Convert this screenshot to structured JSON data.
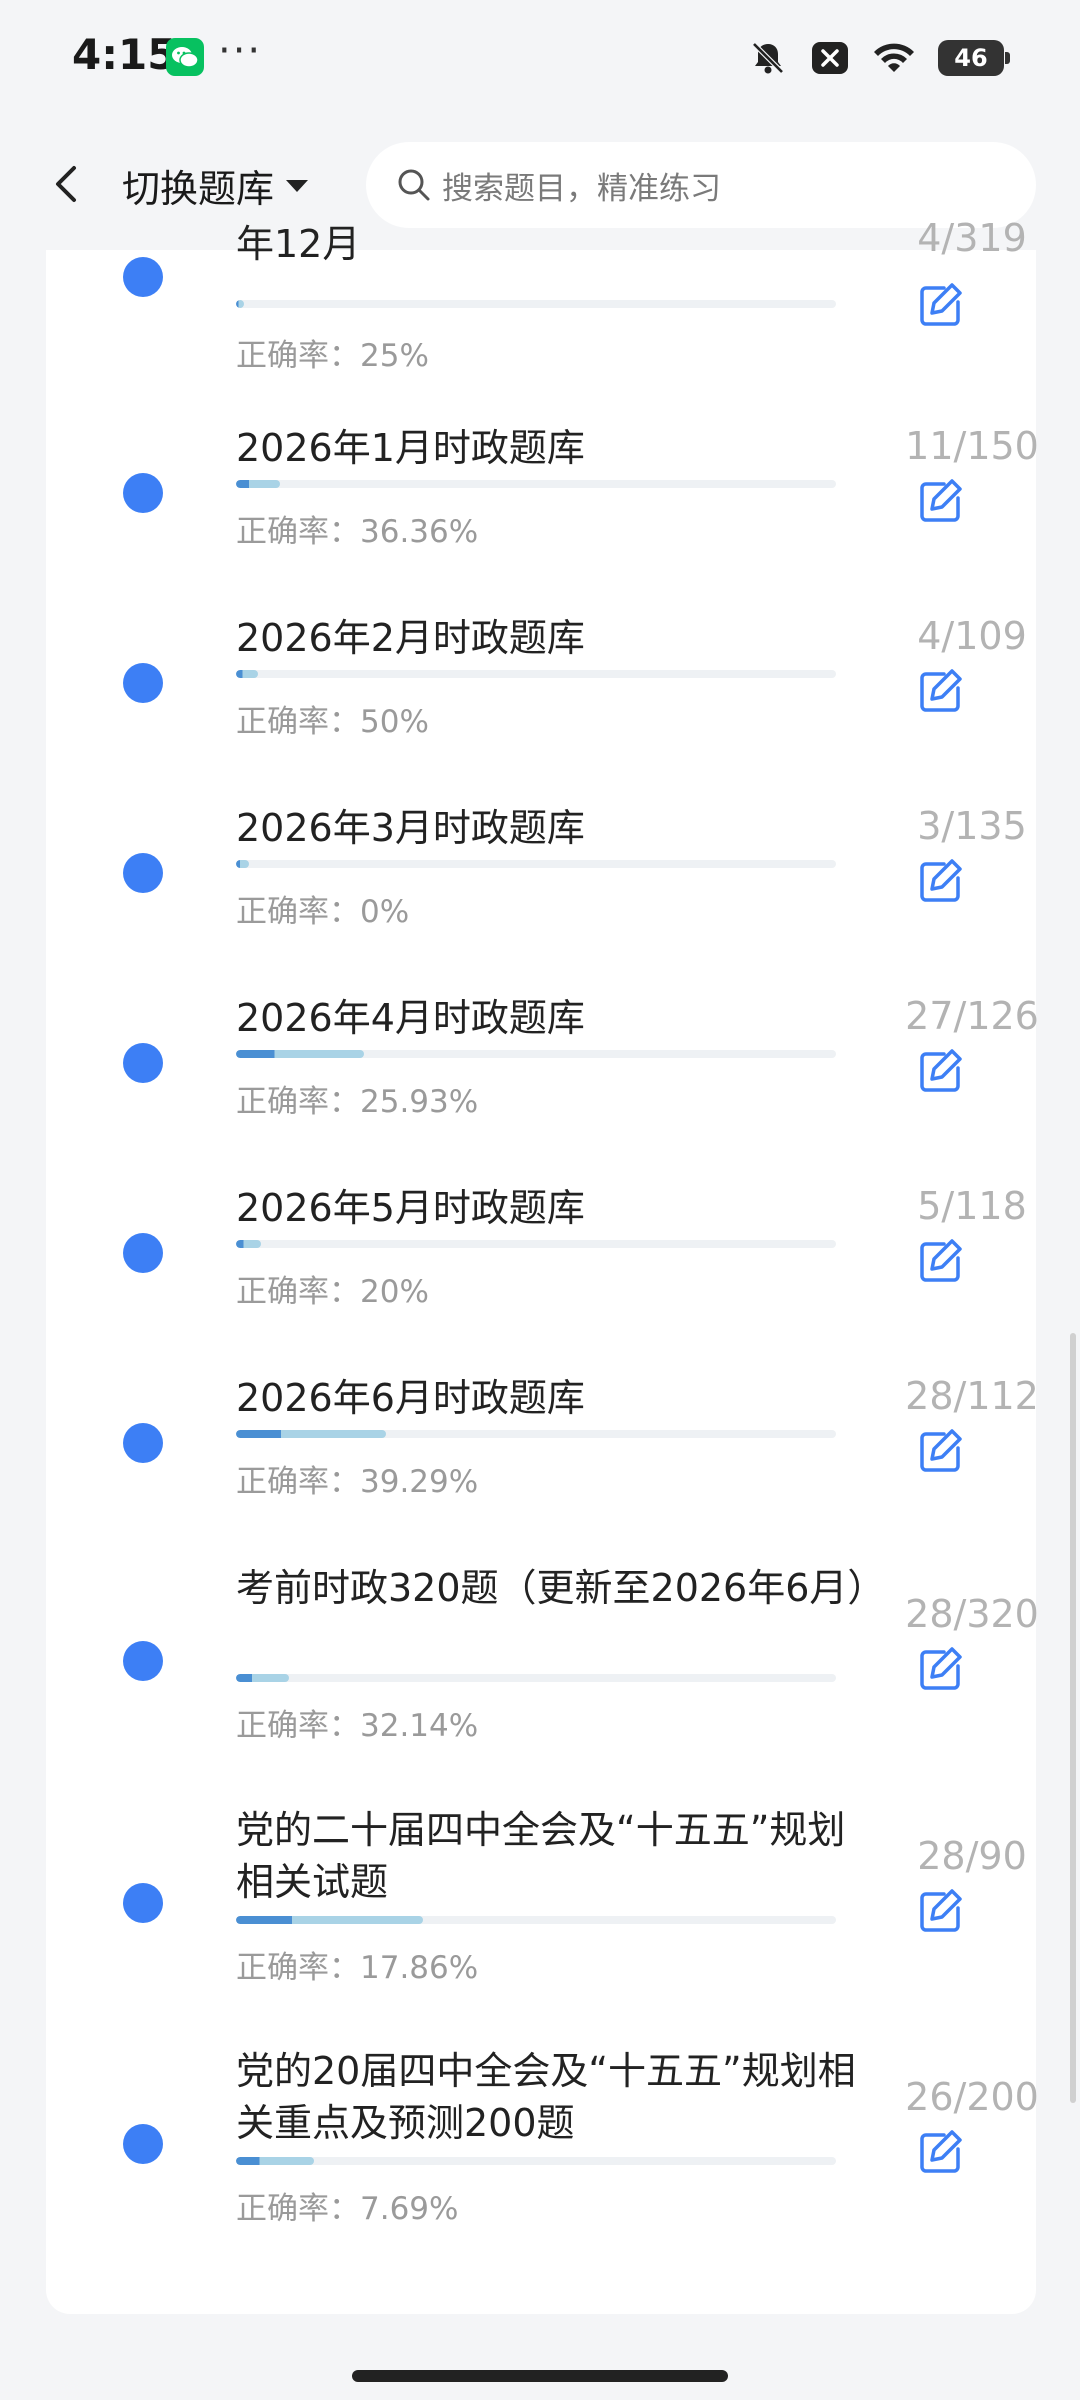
{
  "status_bar": {
    "time": "4:15",
    "dots": "···",
    "battery": "46",
    "icons": [
      "wechat-icon",
      "bell-off-icon",
      "close-box-icon",
      "wifi-icon",
      "battery-icon"
    ]
  },
  "header": {
    "switch_label": "切换题库",
    "search_placeholder": "搜索题目，精准练习"
  },
  "items": [
    {
      "title": "年12月",
      "count": "4/319",
      "accuracy": "正确率：25%",
      "progress": 0.013
    },
    {
      "title": "2026年1月时政题库",
      "count": "11/150",
      "accuracy": "正确率：36.36%",
      "progress": 0.073
    },
    {
      "title": "2026年2月时政题库",
      "count": "4/109",
      "accuracy": "正确率：50%",
      "progress": 0.037
    },
    {
      "title": "2026年3月时政题库",
      "count": "3/135",
      "accuracy": "正确率：0%",
      "progress": 0.022
    },
    {
      "title": "2026年4月时政题库",
      "count": "27/126",
      "accuracy": "正确率：25.93%",
      "progress": 0.214
    },
    {
      "title": "2026年5月时政题库",
      "count": "5/118",
      "accuracy": "正确率：20%",
      "progress": 0.042
    },
    {
      "title": "2026年6月时政题库",
      "count": "28/112",
      "accuracy": "正确率：39.29%",
      "progress": 0.25
    },
    {
      "title": "考前时政320题（更新至2026年6月）",
      "count": "28/320",
      "accuracy": "正确率：32.14%",
      "progress": 0.0875
    },
    {
      "title": "党的二十届四中全会及“十五五”规划相关试题",
      "count": "28/90",
      "accuracy": "正确率：17.86%",
      "progress": 0.311
    },
    {
      "title": "党的20届四中全会及“十五五”规划相关重点及预测200题",
      "count": "26/200",
      "accuracy": "正确率：7.69%",
      "progress": 0.13
    }
  ],
  "colors": {
    "accent": "#3d7ff5",
    "progress_dark": "#4a8fd3",
    "progress_light": "#a9d3e6",
    "count_gray": "#b3b3b3"
  }
}
